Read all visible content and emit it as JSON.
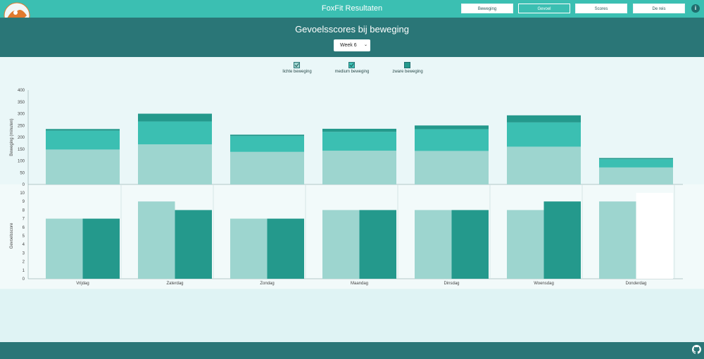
{
  "app": {
    "title": "FoxFit Resultaten",
    "logo_text": "FOXFIT",
    "nav": [
      {
        "label": "Beweging",
        "active": false
      },
      {
        "label": "Gevoel",
        "active": true
      },
      {
        "label": "Scores",
        "active": false
      },
      {
        "label": "De reis",
        "active": false
      }
    ],
    "info_label": "i"
  },
  "page": {
    "title": "Gevoelsscores bij beweging",
    "week_select": "Week 6"
  },
  "legend": [
    {
      "label": "lichte beweging",
      "color": "#9dd5cf",
      "icon": "check-box-icon"
    },
    {
      "label": "medium beweging",
      "color": "#3bbfb2",
      "icon": "check-box-icon"
    },
    {
      "label": "zware beweging",
      "color": "#24998c",
      "icon": "filled-box-icon"
    }
  ],
  "chart_data": [
    {
      "type": "bar",
      "stacked": true,
      "ylabel": "Beweging (minuten)",
      "ylim": [
        0,
        400
      ],
      "yticks": [
        0,
        50,
        100,
        150,
        200,
        250,
        300,
        350,
        400
      ],
      "categories": [
        "Vrijdag",
        "Zaterdag",
        "Zondag",
        "Maandag",
        "Dinsdag",
        "Woensdag",
        "Donderdag"
      ],
      "series": [
        {
          "name": "lichte beweging",
          "color": "#9dd5cf",
          "values": [
            148,
            170,
            138,
            143,
            142,
            160,
            72
          ]
        },
        {
          "name": "medium beweging",
          "color": "#3bbfb2",
          "values": [
            80,
            97,
            67,
            80,
            92,
            103,
            35
          ]
        },
        {
          "name": "zware beweging",
          "color": "#24998c",
          "values": [
            7,
            33,
            6,
            13,
            16,
            30,
            5
          ]
        }
      ]
    },
    {
      "type": "bar",
      "ylabel": "Gevoelsscore",
      "ylim": [
        0,
        10
      ],
      "yticks": [
        0,
        1,
        2,
        3,
        4,
        5,
        6,
        7,
        8,
        9,
        10
      ],
      "categories": [
        "Vrijdag",
        "Zaterdag",
        "Zondag",
        "Maandag",
        "Dinsdag",
        "Woensdag",
        "Donderdag"
      ],
      "series": [
        {
          "color": "#9dd5cf",
          "values": [
            7,
            9,
            7,
            8,
            8,
            8,
            9
          ]
        },
        {
          "color": "#24998c",
          "values": [
            7,
            8,
            7,
            8,
            8,
            9,
            10
          ]
        }
      ],
      "highlight_color": "#ffffff"
    }
  ],
  "footer": {
    "icon": "github-icon"
  }
}
